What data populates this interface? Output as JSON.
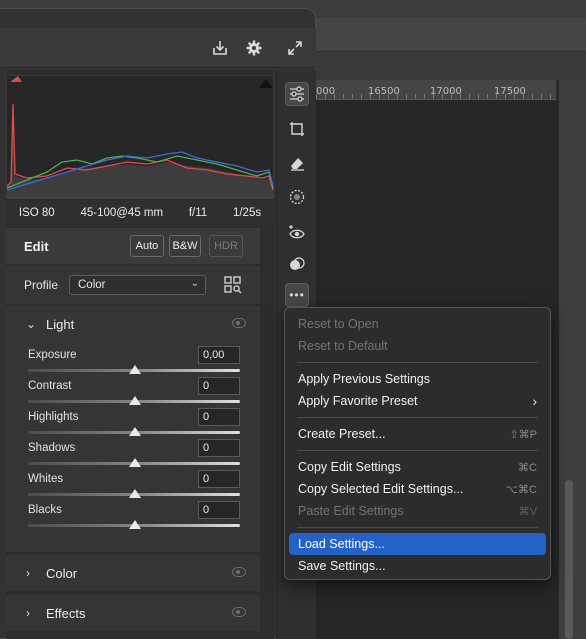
{
  "ruler": {
    "ticks": [
      "000",
      "16500",
      "17000",
      "17500"
    ]
  },
  "header": {
    "export_icon": "export-icon",
    "settings_icon": "gear-icon",
    "expand_icon": "expand-icon"
  },
  "camera_info": {
    "iso": "ISO 80",
    "lens": "45-100@45 mm",
    "aperture": "f/11",
    "shutter": "1/25s"
  },
  "edit": {
    "title": "Edit",
    "auto": "Auto",
    "bw": "B&W",
    "hdr": "HDR"
  },
  "profile": {
    "label": "Profile",
    "value": "Color"
  },
  "light": {
    "title": "Light",
    "sliders": [
      {
        "label": "Exposure",
        "value": "0,00"
      },
      {
        "label": "Contrast",
        "value": "0"
      },
      {
        "label": "Highlights",
        "value": "0"
      },
      {
        "label": "Shadows",
        "value": "0"
      },
      {
        "label": "Whites",
        "value": "0"
      },
      {
        "label": "Blacks",
        "value": "0"
      }
    ]
  },
  "sections": {
    "color": "Color",
    "effects": "Effects"
  },
  "tools": [
    "sliders-icon",
    "crop-icon",
    "eraser-icon",
    "masking-icon",
    "red-eye-icon",
    "presets-icon",
    "more-icon"
  ],
  "menu": {
    "items": [
      {
        "label": "Reset to Open",
        "shortcut": "",
        "disabled": true
      },
      {
        "label": "Reset to Default",
        "shortcut": "",
        "disabled": true
      },
      {
        "label": "Apply Previous Settings",
        "shortcut": "",
        "disabled": false
      },
      {
        "label": "Apply Favorite Preset",
        "shortcut": "›",
        "disabled": false
      },
      {
        "label": "Create Preset...",
        "shortcut": "⇧⌘P",
        "disabled": false
      },
      {
        "label": "Copy Edit Settings",
        "shortcut": "⌘C",
        "disabled": false
      },
      {
        "label": "Copy Selected Edit Settings...",
        "shortcut": "⌥⌘C",
        "disabled": false
      },
      {
        "label": "Paste Edit Settings",
        "shortcut": "⌘V",
        "disabled": true
      },
      {
        "label": "Load Settings...",
        "shortcut": "",
        "disabled": false,
        "highlighted": true
      },
      {
        "label": "Save Settings...",
        "shortcut": "",
        "disabled": false
      }
    ]
  },
  "colors": {
    "highlight": "#2462c7",
    "panel": "#323232",
    "menu_bg": "#2c2c2c"
  }
}
